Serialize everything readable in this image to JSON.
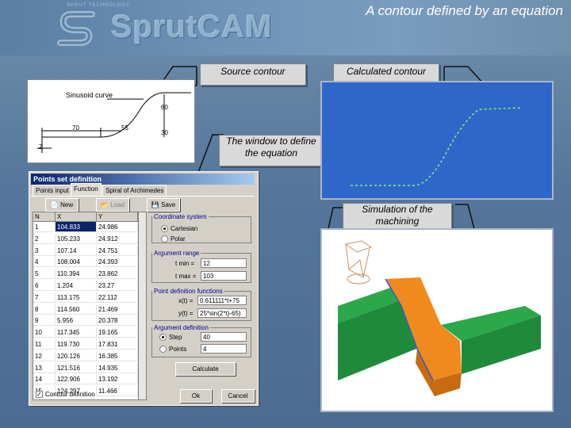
{
  "header": {
    "logo_text": "SprutCAM",
    "logo_tagline": "SPRUT TECHNOLOGY",
    "slide_title": "A contour defined by an equation"
  },
  "labels": {
    "source_contour": "Source contour",
    "calculated_contour": "Calculated contour",
    "equation_window": "The window to define the equation",
    "simulation": "Simulation of the machining"
  },
  "source_drawing": {
    "curve_label": "Sinusoid curve",
    "dim_60": "60",
    "dim_30": "30",
    "dim_70": "70",
    "dim_55": "55",
    "axis_label": "Z"
  },
  "dialog": {
    "title": "Points set definition",
    "tabs": [
      "Points input",
      "Function",
      "Spiral of Archimedes"
    ],
    "toolbar": {
      "new": "New",
      "load": "Load",
      "save": "Save"
    },
    "table": {
      "headers": [
        "N",
        "X",
        "Y"
      ],
      "rows": [
        [
          "1",
          "104.833",
          "24.986"
        ],
        [
          "2",
          "105.233",
          "24.912"
        ],
        [
          "3",
          "107.14",
          "24.751"
        ],
        [
          "4",
          "108.004",
          "24.393"
        ],
        [
          "5",
          "110.394",
          "23.862"
        ],
        [
          "6",
          "1.204",
          "23.27"
        ],
        [
          "7",
          "113.175",
          "22.112"
        ],
        [
          "8",
          "114.560",
          "21.469"
        ],
        [
          "9",
          "5.956",
          "20.378"
        ],
        [
          "10",
          "117.345",
          "19.165"
        ],
        [
          "11",
          "119.730",
          "17.831"
        ],
        [
          "12",
          "120.126",
          "16.385"
        ],
        [
          "13",
          "121.516",
          "14.935"
        ],
        [
          "14",
          "122.906",
          "13.192"
        ],
        [
          "15",
          "124.297",
          "11.466"
        ]
      ]
    },
    "coord_system": {
      "legend": "Coordinate system",
      "options": [
        "Cartesian",
        "Polar"
      ],
      "selected": "Cartesian"
    },
    "argument_range": {
      "legend": "Argument range",
      "min_label": "t min =",
      "min_value": "12",
      "max_label": "t max =",
      "max_value": "103"
    },
    "point_functions": {
      "legend": "Point definition functions",
      "x_label": "x(t) =",
      "x_value": "0.611111*t+75",
      "y_label": "y(t) =",
      "y_value": "25*sin(2*t)-65)"
    },
    "argument_definition": {
      "legend": "Argument definition",
      "options": [
        "Step",
        "Points"
      ],
      "selected": "Step",
      "step_value": "40",
      "points_value": "4"
    },
    "calculate_button": "Calculate",
    "contour_checkbox": "Contour definition",
    "contour_checked": true,
    "ok_button": "Ok",
    "cancel_button": "Cancel"
  },
  "colors": {
    "calc_bg": "#2f66c9",
    "curve": "#7df07a",
    "part_green": "#1f8a3a",
    "part_orange": "#f08a1c"
  }
}
